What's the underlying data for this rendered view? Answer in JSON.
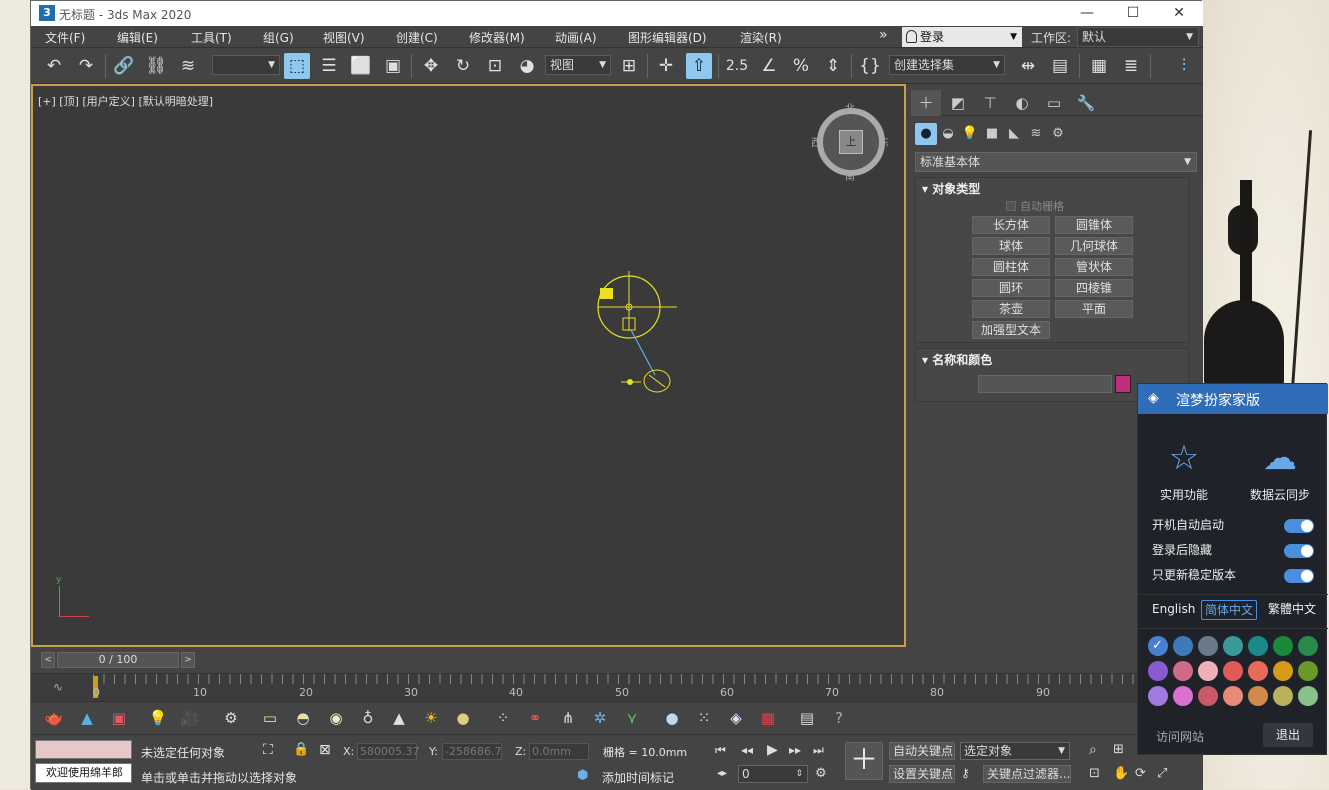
{
  "window": {
    "title": "无标题 - 3ds Max 2020",
    "app_icon": "3",
    "minimize": "—",
    "maximize": "☐",
    "close": "✕"
  },
  "menu": [
    "文件(F)",
    "编辑(E)",
    "工具(T)",
    "组(G)",
    "视图(V)",
    "创建(C)",
    "修改器(M)",
    "动画(A)",
    "图形编辑器(D)",
    "渲染(R)"
  ],
  "menu_overflow": "»",
  "login": {
    "label": "登录"
  },
  "workspace": {
    "label": "工作区:",
    "value": "默认"
  },
  "toolbar": {
    "ref_coord": "视图",
    "selection_set": "创建选择集",
    "snap_label": "2.5"
  },
  "viewport": {
    "label": "[+] [顶] [用户定义] [默认明暗处理]",
    "cube_face": "上",
    "north": "北",
    "south": "南",
    "west": "西",
    "east": "东",
    "axis_y": "y"
  },
  "command_panel": {
    "category": "标准基本体",
    "object_type": {
      "title": "对象类型",
      "autogrid": "自动栅格",
      "buttons": [
        "长方体",
        "圆锥体",
        "球体",
        "几何球体",
        "圆柱体",
        "管状体",
        "圆环",
        "四棱锥",
        "茶壶",
        "平面",
        "加强型文本"
      ]
    },
    "name_color": {
      "title": "名称和颜色",
      "swatch_color": "#c0307a"
    }
  },
  "timeline": {
    "position": "0 / 100",
    "ticks": [
      "0",
      "10",
      "20",
      "30",
      "40",
      "50",
      "60",
      "70",
      "80",
      "90"
    ]
  },
  "status": {
    "welcome": "欢迎使用绵羊郎",
    "selection": "未选定任何对象",
    "prompt": "单击或单击并拖动以选择对象",
    "x_label": "X:",
    "x_value": "580005.37",
    "y_label": "Y:",
    "y_value": "-258686.7",
    "z_label": "Z:",
    "z_value": "0.0mm",
    "grid": "栅格 = 10.0mm",
    "add_time_tag": "添加时间标记",
    "auto_key": "自动关键点",
    "set_key": "设置关键点",
    "key_target": "选定对象",
    "key_filters": "关键点过滤器...",
    "frame": "0"
  },
  "popup": {
    "title": "渲梦扮家家版",
    "features": [
      {
        "label": "实用功能"
      },
      {
        "label": "数据云同步"
      }
    ],
    "toggles": [
      "开机自动启动",
      "登录后隐藏",
      "只更新稳定版本"
    ],
    "languages": [
      "English",
      "简体中文",
      "繁體中文"
    ],
    "selected_language": "简体中文",
    "colors": [
      "#4a7fd0",
      "#3c7ab8",
      "#6b7a88",
      "#3a9a9a",
      "#1a8a8a",
      "#1a8a3a",
      "#2a8a4a",
      "#8a5ad0",
      "#d06a8a",
      "#f0b0b8",
      "#e05a5a",
      "#e86a5a",
      "#d89a1a",
      "#6a9a2a",
      "#a07ae0",
      "#d870d0",
      "#c85a6a",
      "#e88a7a",
      "#d08a4a",
      "#b8b05a",
      "#8ac08a"
    ],
    "selected_color": "#4a7fd0",
    "visit": "访问网站",
    "exit": "退出"
  }
}
